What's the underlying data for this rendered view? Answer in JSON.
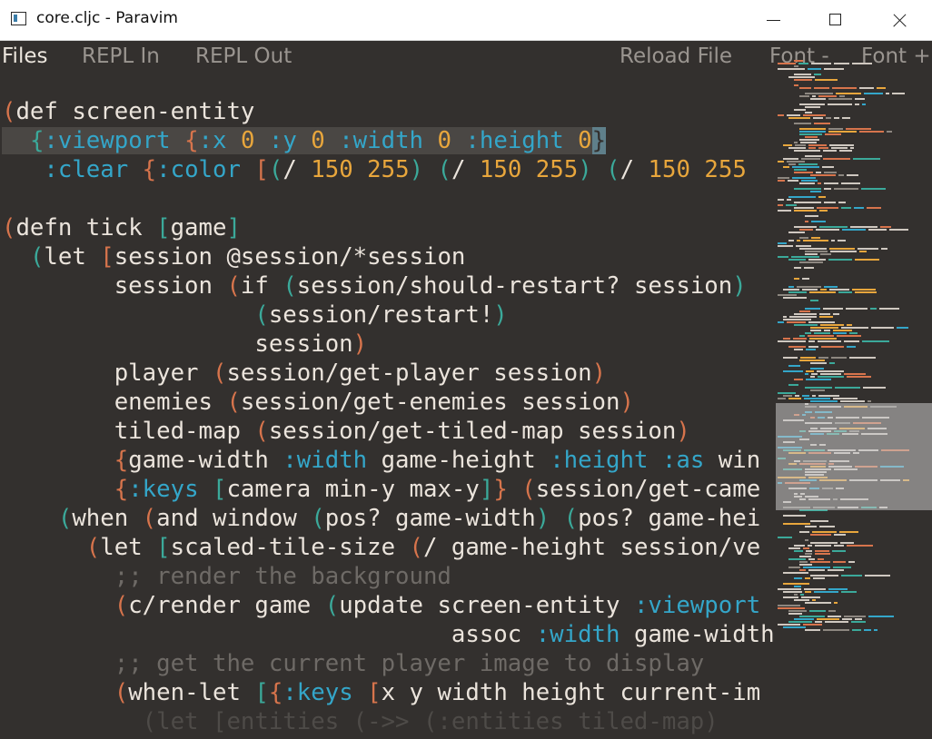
{
  "window": {
    "title": "core.cljc - Paravim"
  },
  "menu": {
    "files": "Files",
    "repl_in": "REPL In",
    "repl_out": "REPL Out",
    "reload_file": "Reload File",
    "font_minus": "Font -",
    "font_plus": "Font +"
  },
  "editor": {
    "file": "core.cljc",
    "lines": [
      [
        [
          "p1",
          "("
        ],
        [
          "t",
          "def screen-entity"
        ]
      ],
      [
        [
          "t",
          "  "
        ],
        [
          "p2",
          "{"
        ],
        [
          "kw",
          ":viewport "
        ],
        [
          "p3",
          "{"
        ],
        [
          "kw",
          ":x "
        ],
        [
          "num",
          "0"
        ],
        [
          "t",
          " "
        ],
        [
          "kw",
          ":y "
        ],
        [
          "num",
          "0"
        ],
        [
          "t",
          " "
        ],
        [
          "kw",
          ":width "
        ],
        [
          "num",
          "0"
        ],
        [
          "t",
          " "
        ],
        [
          "kw",
          ":height "
        ],
        [
          "num",
          "0"
        ],
        [
          "cur",
          "}"
        ]
      ],
      [
        [
          "t",
          "   "
        ],
        [
          "kw",
          ":clear "
        ],
        [
          "p3",
          "{"
        ],
        [
          "kw",
          ":color "
        ],
        [
          "p1",
          "["
        ],
        [
          "p2",
          "("
        ],
        [
          "t",
          "/ "
        ],
        [
          "num",
          "150"
        ],
        [
          "t",
          " "
        ],
        [
          "num",
          "255"
        ],
        [
          "p2",
          ")"
        ],
        [
          "t",
          " "
        ],
        [
          "p2",
          "("
        ],
        [
          "t",
          "/ "
        ],
        [
          "num",
          "150"
        ],
        [
          "t",
          " "
        ],
        [
          "num",
          "255"
        ],
        [
          "p2",
          ")"
        ],
        [
          "t",
          " "
        ],
        [
          "p2",
          "("
        ],
        [
          "t",
          "/ "
        ],
        [
          "num",
          "150"
        ],
        [
          "t",
          " "
        ],
        [
          "num",
          "255"
        ]
      ],
      [
        [
          "t",
          ""
        ]
      ],
      [
        [
          "p1",
          "("
        ],
        [
          "t",
          "defn tick "
        ],
        [
          "p2",
          "["
        ],
        [
          "t",
          "game"
        ],
        [
          "p2",
          "]"
        ]
      ],
      [
        [
          "t",
          "  "
        ],
        [
          "p2",
          "("
        ],
        [
          "t",
          "let "
        ],
        [
          "p3",
          "["
        ],
        [
          "t",
          "session @session/*session"
        ]
      ],
      [
        [
          "t",
          "        session "
        ],
        [
          "p1",
          "("
        ],
        [
          "t",
          "if "
        ],
        [
          "p2",
          "("
        ],
        [
          "t",
          "session/should-restart? session"
        ],
        [
          "p2",
          ")"
        ]
      ],
      [
        [
          "t",
          "                  "
        ],
        [
          "p2",
          "("
        ],
        [
          "t",
          "session/restart!"
        ],
        [
          "p2",
          ")"
        ]
      ],
      [
        [
          "t",
          "                  session"
        ],
        [
          "p1",
          ")"
        ]
      ],
      [
        [
          "t",
          "        player "
        ],
        [
          "p1",
          "("
        ],
        [
          "t",
          "session/get-player session"
        ],
        [
          "p1",
          ")"
        ]
      ],
      [
        [
          "t",
          "        enemies "
        ],
        [
          "p1",
          "("
        ],
        [
          "t",
          "session/get-enemies session"
        ],
        [
          "p1",
          ")"
        ]
      ],
      [
        [
          "t",
          "        tiled-map "
        ],
        [
          "p1",
          "("
        ],
        [
          "t",
          "session/get-tiled-map session"
        ],
        [
          "p1",
          ")"
        ]
      ],
      [
        [
          "t",
          "        "
        ],
        [
          "p1",
          "{"
        ],
        [
          "t",
          "game-width "
        ],
        [
          "kw",
          ":width"
        ],
        [
          "t",
          " game-height "
        ],
        [
          "kw",
          ":height :as"
        ],
        [
          "t",
          " win"
        ]
      ],
      [
        [
          "t",
          "        "
        ],
        [
          "p1",
          "{"
        ],
        [
          "kw",
          ":keys "
        ],
        [
          "p2",
          "["
        ],
        [
          "t",
          "camera min-y max-y"
        ],
        [
          "p2",
          "]"
        ],
        [
          "p1",
          "}"
        ],
        [
          "t",
          " "
        ],
        [
          "p1",
          "("
        ],
        [
          "t",
          "session/get-came"
        ]
      ],
      [
        [
          "t",
          "    "
        ],
        [
          "p2",
          "("
        ],
        [
          "t",
          "when "
        ],
        [
          "p1",
          "("
        ],
        [
          "t",
          "and window "
        ],
        [
          "p2",
          "("
        ],
        [
          "t",
          "pos? game-width"
        ],
        [
          "p2",
          ")"
        ],
        [
          "t",
          " "
        ],
        [
          "p2",
          "("
        ],
        [
          "t",
          "pos? game-hei"
        ]
      ],
      [
        [
          "t",
          "      "
        ],
        [
          "p1",
          "("
        ],
        [
          "t",
          "let "
        ],
        [
          "p2",
          "["
        ],
        [
          "t",
          "scaled-tile-size "
        ],
        [
          "p1",
          "("
        ],
        [
          "t",
          "/ game-height session/ve"
        ]
      ],
      [
        [
          "t",
          "        "
        ],
        [
          "cm",
          ";; render the background"
        ]
      ],
      [
        [
          "t",
          "        "
        ],
        [
          "p1",
          "("
        ],
        [
          "t",
          "c/render game "
        ],
        [
          "p2",
          "("
        ],
        [
          "t",
          "update screen-entity "
        ],
        [
          "kw",
          ":viewport"
        ]
      ],
      [
        [
          "t",
          "                                assoc "
        ],
        [
          "kw",
          ":width"
        ],
        [
          "t",
          " game-width"
        ]
      ],
      [
        [
          "t",
          "        "
        ],
        [
          "cm",
          ";; get the current player image to display"
        ]
      ],
      [
        [
          "t",
          "        "
        ],
        [
          "p1",
          "("
        ],
        [
          "t",
          "when-let "
        ],
        [
          "p2",
          "["
        ],
        [
          "p3",
          "{"
        ],
        [
          "kw",
          ":keys "
        ],
        [
          "p1",
          "["
        ],
        [
          "t",
          "x y width height current-im"
        ]
      ],
      [
        [
          "fade",
          "          (let [entities (->> (:entities tiled-map)"
        ]
      ]
    ]
  }
}
